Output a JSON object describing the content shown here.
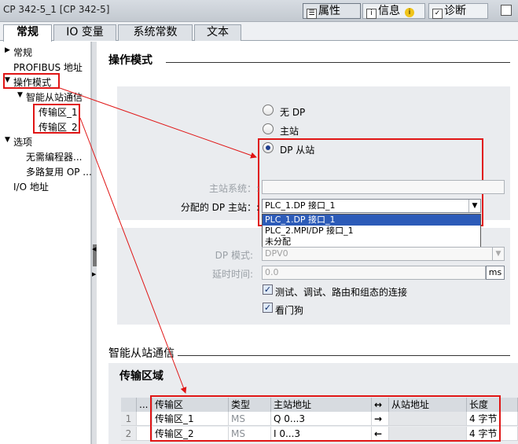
{
  "window": {
    "title": "CP 342-5_1 [CP 342-5]"
  },
  "inspector_tabs": [
    {
      "label": "属性",
      "icon": "properties-icon"
    },
    {
      "label": "信息",
      "icon": "info-icon"
    },
    {
      "label": "诊断",
      "icon": "diagnostics-icon"
    }
  ],
  "tabs": [
    "常规",
    "IO 变量",
    "系统常数",
    "文本"
  ],
  "sidebar": {
    "items": [
      "常规",
      "PROFIBUS 地址",
      "操作模式",
      "智能从站通信",
      "传输区_1",
      "传输区_2",
      "选项",
      "无需编程器...",
      "多路复用 OP ...",
      "I/O 地址"
    ]
  },
  "section_mode": {
    "title": "操作模式",
    "radios": [
      "无 DP",
      "主站",
      "DP 从站"
    ],
    "selected_index": 2,
    "master_system_label": "主站系统：:",
    "master_system_value": "",
    "assigned_master_label": "分配的 DP 主站：:",
    "assigned_master_value": "PLC_1.DP 接口_1",
    "dropdown_options": [
      "PLC_1.DP 接口_1",
      "PLC_2.MPI/DP 接口_1",
      "未分配"
    ],
    "dp_mode_label": "DP 模式:",
    "dp_mode_value": "DPV0",
    "watchdog_time_label": "延时时间:",
    "watchdog_time_value": "0.0",
    "watchdog_unit": "ms",
    "checkbox_test": "测试、调试、路由和组态的连接",
    "checkbox_watchdog": "看门狗"
  },
  "section_slave": {
    "title": "智能从站通信",
    "subtitle": "传输区域",
    "columns": [
      "...",
      "传输区",
      "类型",
      "主站地址",
      "↔",
      "从站地址",
      "长度"
    ],
    "rows": [
      {
        "no": "1",
        "area": "传输区_1",
        "type": "MS",
        "master_addr": "Q 0...3",
        "dir": "→",
        "slave_addr": "",
        "length": "4 字节"
      },
      {
        "no": "2",
        "area": "传输区_2",
        "type": "MS",
        "master_addr": "I 0...3",
        "dir": "←",
        "slave_addr": "",
        "length": "4 字节"
      }
    ]
  }
}
